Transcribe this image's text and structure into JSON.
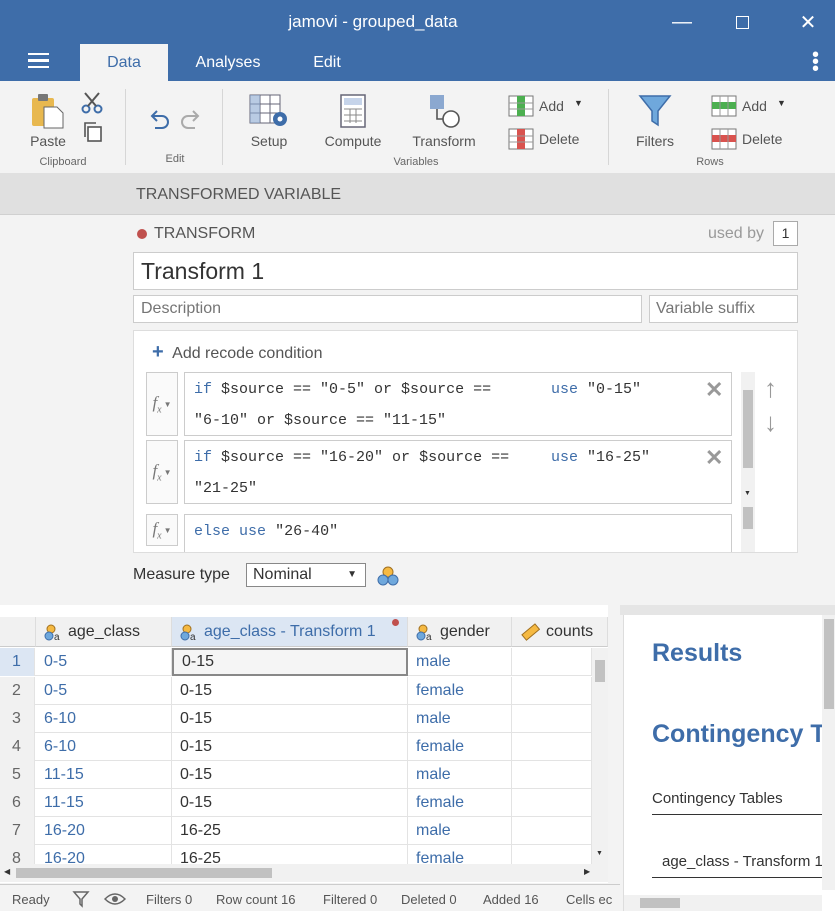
{
  "window": {
    "title": "jamovi - grouped_data"
  },
  "tabs": [
    {
      "label": "Data"
    },
    {
      "label": "Analyses"
    },
    {
      "label": "Edit"
    }
  ],
  "ribbon": {
    "paste": "Paste",
    "clipboard_group": "Clipboard",
    "edit_group": "Edit",
    "setup": "Setup",
    "compute": "Compute",
    "transform": "Transform",
    "add_var": "Add",
    "delete_var": "Delete",
    "variables_group": "Variables",
    "filters": "Filters",
    "add_row": "Add",
    "delete_row": "Delete",
    "rows_group": "Rows"
  },
  "section_header": "TRANSFORMED VARIABLE",
  "transform": {
    "heading": "TRANSFORM",
    "used_by_label": "used by",
    "used_by_count": "1",
    "name": "Transform 1",
    "description_placeholder": "Description",
    "suffix_placeholder": "Variable suffix",
    "add_condition": "Add recode condition",
    "conditions": [
      {
        "if_kw": "if",
        "expr1": "$source == \"0-5\" or $source ==",
        "expr2": "\"6-10\" or $source == \"11-15\"",
        "use_kw": "use",
        "value": "\"0-15\""
      },
      {
        "if_kw": "if",
        "expr1": "$source == \"16-20\" or $source ==",
        "expr2": "\"21-25\"",
        "use_kw": "use",
        "value": "\"16-25\""
      }
    ],
    "else": {
      "else_kw": "else",
      "use_kw": "use",
      "value": "\"26-40\""
    },
    "measure_label": "Measure type",
    "measure_value": "Nominal"
  },
  "grid": {
    "columns": [
      "age_class",
      "age_class - Transform 1",
      "gender",
      "counts"
    ],
    "rows": [
      {
        "n": "1",
        "age_class": "0-5",
        "transform": "0-15",
        "gender": "male"
      },
      {
        "n": "2",
        "age_class": "0-5",
        "transform": "0-15",
        "gender": "female"
      },
      {
        "n": "3",
        "age_class": "6-10",
        "transform": "0-15",
        "gender": "male"
      },
      {
        "n": "4",
        "age_class": "6-10",
        "transform": "0-15",
        "gender": "female"
      },
      {
        "n": "5",
        "age_class": "11-15",
        "transform": "0-15",
        "gender": "male"
      },
      {
        "n": "6",
        "age_class": "11-15",
        "transform": "0-15",
        "gender": "female"
      },
      {
        "n": "7",
        "age_class": "16-20",
        "transform": "16-25",
        "gender": "male"
      },
      {
        "n": "8",
        "age_class": "16-20",
        "transform": "16-25",
        "gender": "female"
      }
    ]
  },
  "status": {
    "ready": "Ready",
    "filters": "Filters 0",
    "row_count": "Row count 16",
    "filtered": "Filtered 0",
    "deleted": "Deleted 0",
    "added": "Added 16",
    "cells": "Cells ec"
  },
  "results": {
    "title": "Results",
    "heading": "Contingency T",
    "subheading": "Contingency Tables",
    "table_label": "age_class - Transform 1"
  },
  "colors": {
    "accent": "#3e6da9",
    "dot": "#c0504d"
  }
}
